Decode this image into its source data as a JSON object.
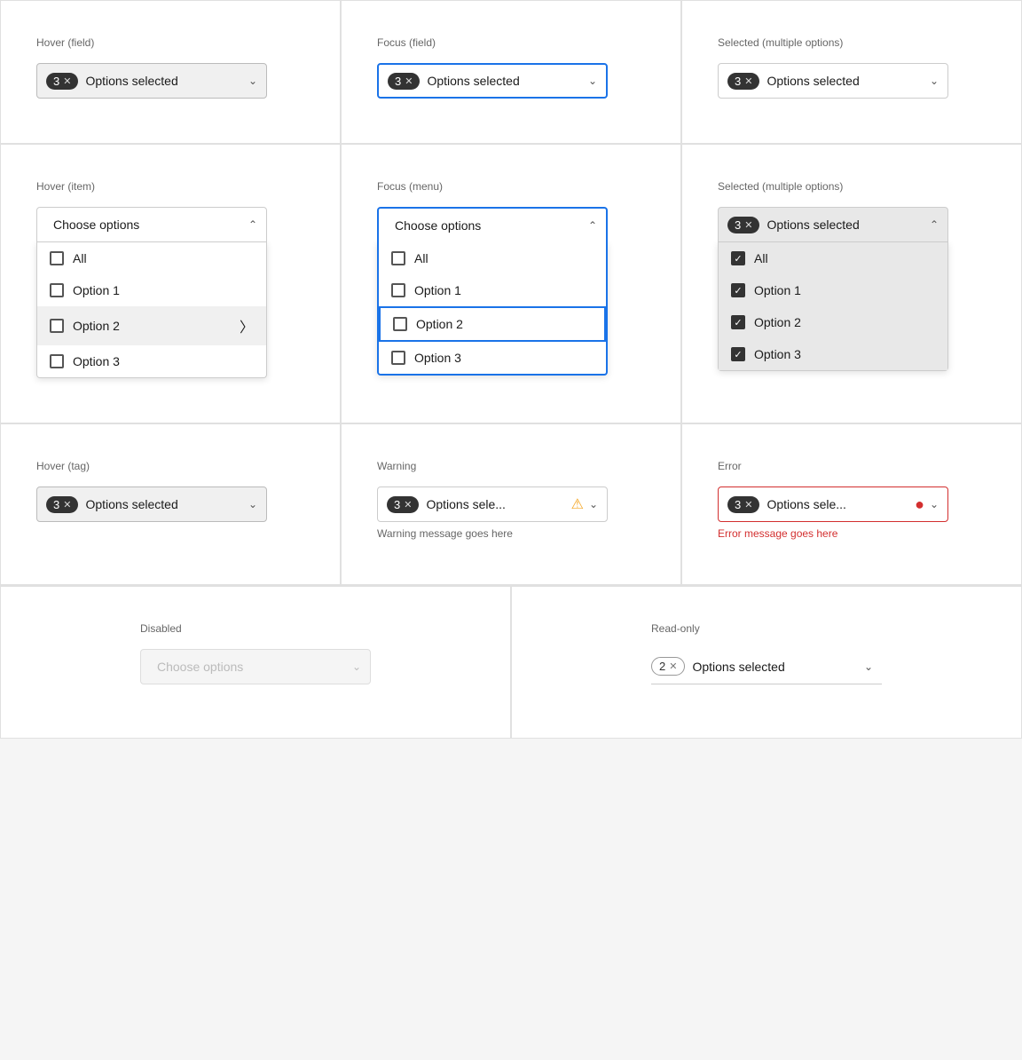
{
  "cells": [
    {
      "id": "hover-field",
      "label": "Hover (field)",
      "badge_count": "3",
      "text": "Options selected",
      "state": "hover",
      "show_chevron": "chevron-down",
      "chevron_dir": "down"
    },
    {
      "id": "focus-field",
      "label": "Focus (field)",
      "badge_count": "3",
      "text": "Options selected",
      "state": "focus",
      "show_chevron": "chevron-down",
      "chevron_dir": "down"
    },
    {
      "id": "selected-multiple-1",
      "label": "Selected (multiple options)",
      "badge_count": "3",
      "text": "Options selected",
      "state": "default",
      "show_chevron": "chevron-down",
      "chevron_dir": "down"
    },
    {
      "id": "hover-item",
      "label": "Hover (item)",
      "placeholder": "Choose options",
      "state": "open",
      "chevron_dir": "up",
      "items": [
        {
          "label": "All",
          "checked": false,
          "hovered": false
        },
        {
          "label": "Option 1",
          "checked": false,
          "hovered": false
        },
        {
          "label": "Option 2",
          "checked": false,
          "hovered": true
        },
        {
          "label": "Option 3",
          "checked": false,
          "hovered": false
        }
      ]
    },
    {
      "id": "focus-menu",
      "label": "Focus (menu)",
      "placeholder": "Choose options",
      "state": "focus-open",
      "chevron_dir": "up",
      "items": [
        {
          "label": "All",
          "checked": false,
          "hovered": false
        },
        {
          "label": "Option 1",
          "checked": false,
          "hovered": false
        },
        {
          "label": "Option 2",
          "checked": false,
          "hovered": false,
          "focused": true
        },
        {
          "label": "Option 3",
          "checked": false,
          "hovered": false
        }
      ]
    },
    {
      "id": "selected-multiple-2",
      "label": "Selected (multiple options)",
      "badge_count": "3",
      "text": "Options selected",
      "state": "open-selected",
      "chevron_dir": "up",
      "items": [
        {
          "label": "All",
          "checked": true
        },
        {
          "label": "Option 1",
          "checked": true
        },
        {
          "label": "Option 2",
          "checked": true
        },
        {
          "label": "Option 3",
          "checked": true
        }
      ]
    },
    {
      "id": "hover-tag",
      "label": "Hover (tag)",
      "badge_count": "3",
      "text": "Options selected",
      "state": "hover-tag",
      "show_chevron": "chevron-down",
      "chevron_dir": "down"
    },
    {
      "id": "warning",
      "label": "Warning",
      "badge_count": "3",
      "text": "Options sele...",
      "state": "warning",
      "show_chevron": "chevron-down",
      "chevron_dir": "down",
      "message": "Warning message goes here"
    },
    {
      "id": "error",
      "label": "Error",
      "badge_count": "3",
      "text": "Options sele...",
      "state": "error",
      "show_chevron": "chevron-down",
      "chevron_dir": "down",
      "message": "Error message goes here"
    }
  ],
  "bottom": [
    {
      "id": "disabled",
      "label": "Disabled",
      "placeholder": "Choose options",
      "state": "disabled"
    },
    {
      "id": "readonly",
      "label": "Read-only",
      "badge_count": "2",
      "text": "Options selected",
      "state": "readonly"
    }
  ]
}
